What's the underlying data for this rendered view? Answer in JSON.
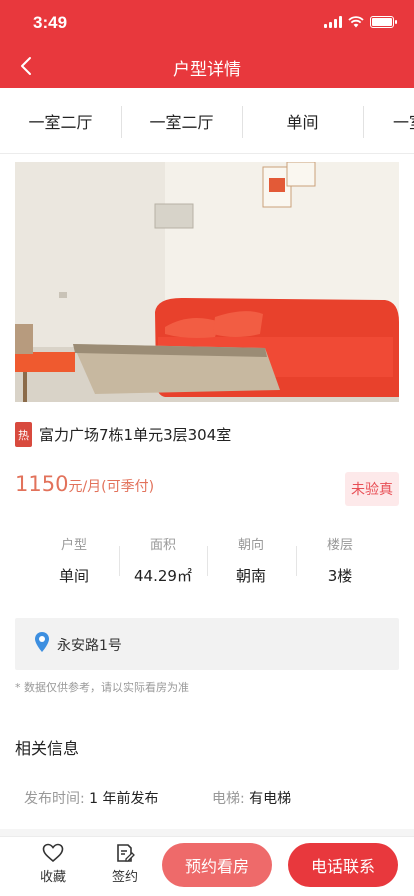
{
  "status_bar": {
    "time": "3:49"
  },
  "nav": {
    "title": "户型详情"
  },
  "tabs": [
    "一室二厅",
    "一室二厅",
    "单间",
    "一室"
  ],
  "listing": {
    "hot_badge": "热",
    "address": "富力广场7栋1单元3层304室",
    "price_number": "1150",
    "price_unit": "元/月(可季付)",
    "verify_badge": "未验真",
    "specs": [
      {
        "label": "户型",
        "value": "单间"
      },
      {
        "label": "面积",
        "value": "44.29㎡"
      },
      {
        "label": "朝向",
        "value": "朝南"
      },
      {
        "label": "楼层",
        "value": "3楼"
      }
    ],
    "location": "永安路1号",
    "disclaimer": "* 数据仅供参考，请以实际看房为准"
  },
  "related": {
    "title": "相关信息",
    "publish_label": "发布时间:",
    "publish_value": "1 年前发布",
    "elevator_label": "电梯:",
    "elevator_value": "有电梯"
  },
  "bottom_bar": {
    "favorite": "收藏",
    "sign": "签约",
    "appointment": "预约看房",
    "call": "电话联系"
  },
  "colors": {
    "brand_red": "#e8383d",
    "appointment_pink": "#ee6a6a",
    "price_orange": "#e2725b",
    "location_pin_blue": "#3d8fe0"
  },
  "icons": [
    "back-chevron-icon",
    "signal-icon",
    "wifi-icon",
    "battery-icon",
    "heart-icon",
    "sign-edit-icon",
    "location-pin-icon"
  ]
}
